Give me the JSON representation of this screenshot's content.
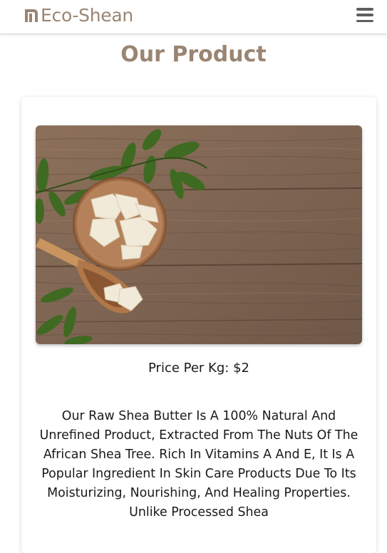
{
  "header": {
    "brand": "Eco-Shean",
    "logo_icon": "eco-shean-logo-icon",
    "menu_icon": "hamburger-menu-icon"
  },
  "main": {
    "title": "Our Product"
  },
  "product": {
    "image_icon": "shea-butter-photo",
    "price": "Price Per Kg: $2",
    "description": "Our Raw Shea Butter Is A 100% Natural And Unrefined Product, Extracted From The Nuts Of The African Shea Tree. Rich In Vitamins A And E, It Is A Popular Ingredient In Skin Care Products Due To Its Moisturizing, Nourishing, And Healing Properties. Unlike Processed Shea"
  },
  "colors": {
    "brand": "#9a8572",
    "text": "#1a1a1a",
    "menu_icon": "#5e5e5e"
  }
}
